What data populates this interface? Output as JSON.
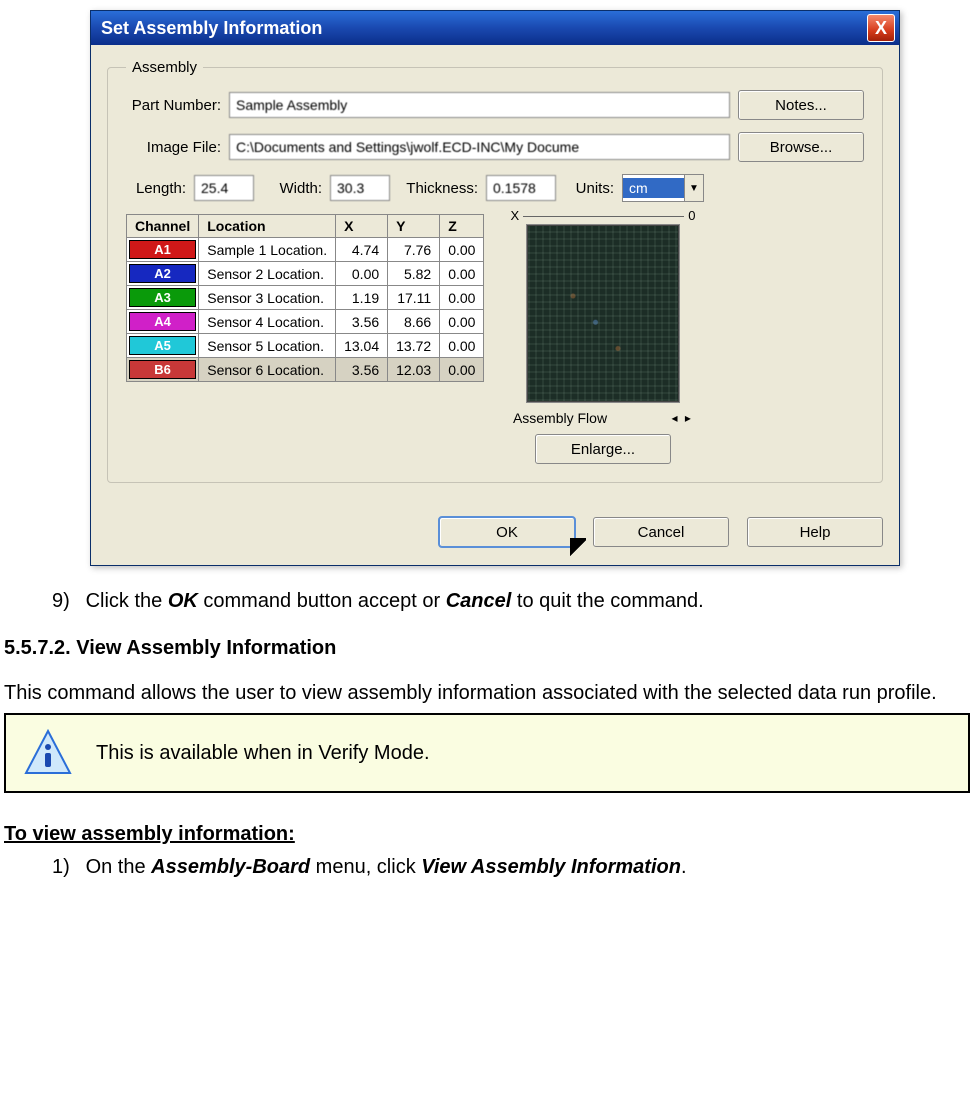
{
  "dialog": {
    "title": "Set Assembly Information",
    "close": "X",
    "legend": "Assembly",
    "partNumberLabel": "Part Number:",
    "partNumber": "Sample Assembly",
    "notesBtn": "Notes...",
    "imageFileLabel": "Image File:",
    "imageFile": "C:\\Documents and Settings\\jwolf.ECD-INC\\My Docume",
    "browseBtn": "Browse...",
    "lengthLabel": "Length:",
    "length": "25.4",
    "widthLabel": "Width:",
    "width": "30.3",
    "thicknessLabel": "Thickness:",
    "thickness": "0.1578",
    "unitsLabel": "Units:",
    "units": "cm",
    "table": {
      "headers": [
        "Channel",
        "Location",
        "X",
        "Y",
        "Z"
      ],
      "rows": [
        {
          "ch": "A1",
          "color": "#d01818",
          "loc": "Sample 1 Location.",
          "x": "4.74",
          "y": "7.76",
          "z": "0.00"
        },
        {
          "ch": "A2",
          "color": "#1628c0",
          "loc": "Sensor 2 Location.",
          "x": "0.00",
          "y": "5.82",
          "z": "0.00"
        },
        {
          "ch": "A3",
          "color": "#0a9a0a",
          "loc": "Sensor 3 Location.",
          "x": "1.19",
          "y": "17.11",
          "z": "0.00"
        },
        {
          "ch": "A4",
          "color": "#d020c8",
          "loc": "Sensor 4 Location.",
          "x": "3.56",
          "y": "8.66",
          "z": "0.00"
        },
        {
          "ch": "A5",
          "color": "#20c8d8",
          "loc": "Sensor 5 Location.",
          "x": "13.04",
          "y": "13.72",
          "z": "0.00"
        },
        {
          "ch": "B6",
          "color": "#c83838",
          "loc": "Sensor 6 Location.",
          "x": "3.56",
          "y": "12.03",
          "z": "0.00",
          "sel": true
        }
      ]
    },
    "previewTop": {
      "left": "X",
      "right": "0"
    },
    "assemblyFlow": "Assembly Flow",
    "enlarge": "Enlarge...",
    "ok": "OK",
    "cancel": "Cancel",
    "help": "Help"
  },
  "doc": {
    "step9_pre": "Click the ",
    "step9_b1": "OK",
    "step9_mid": " command button accept or ",
    "step9_b2": "Cancel",
    "step9_post": " to quit the command.",
    "h": "5.5.7.2. View Assembly Information",
    "para": "This command allows the user to view assembly information associated with the selected data run profile.",
    "note": "This is available when in Verify Mode.",
    "u": "To view assembly information:",
    "step1_pre": "On the ",
    "step1_b1": "Assembly-Board",
    "step1_mid": " menu, click ",
    "step1_b2": "View Assembly Information",
    "step1_post": "."
  }
}
